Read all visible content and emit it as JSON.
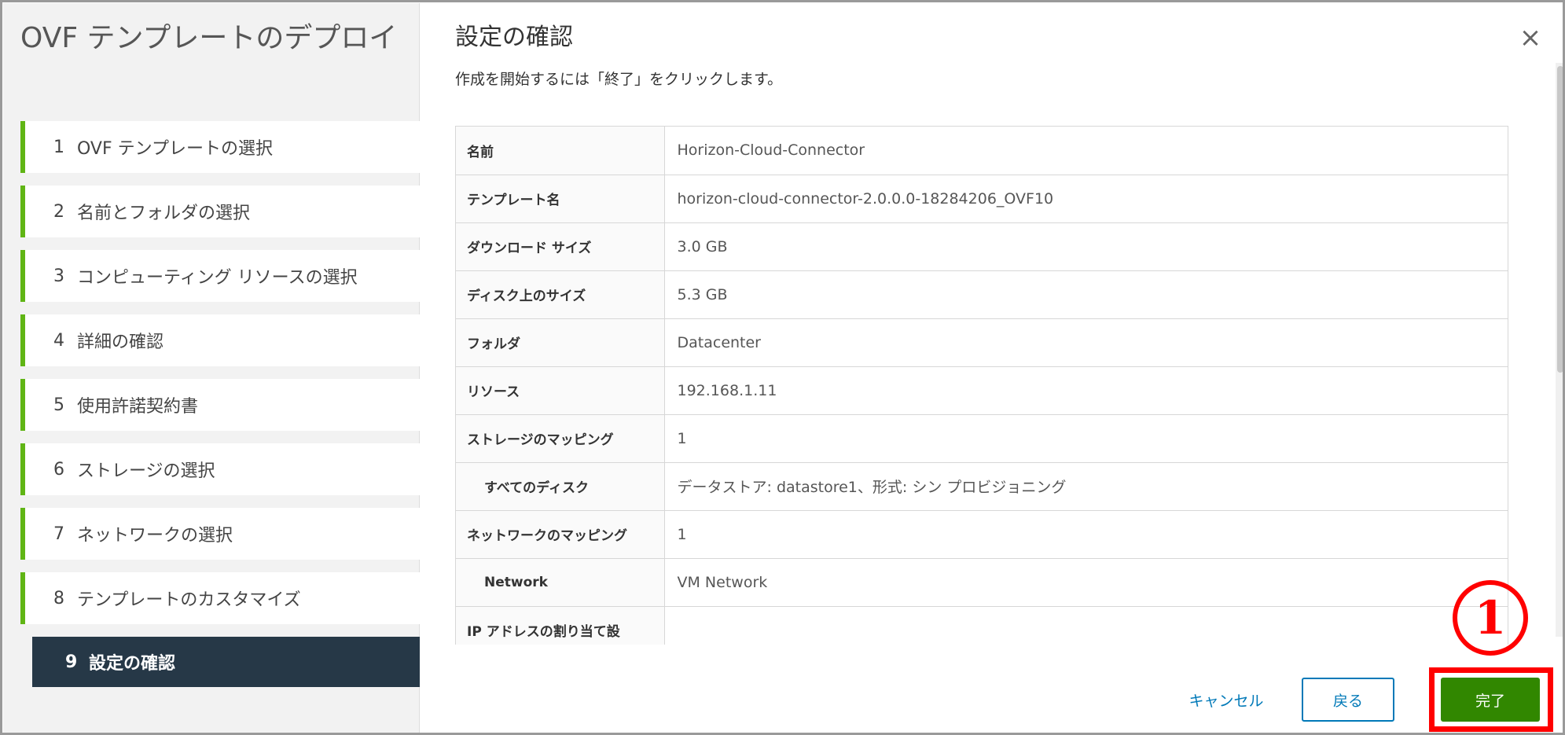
{
  "wizard": {
    "title": "OVF テンプレートのデプロイ",
    "steps": [
      {
        "num": "1",
        "label": "OVF テンプレートの選択"
      },
      {
        "num": "2",
        "label": "名前とフォルダの選択"
      },
      {
        "num": "3",
        "label": "コンピューティング リソースの選択"
      },
      {
        "num": "4",
        "label": "詳細の確認"
      },
      {
        "num": "5",
        "label": "使用許諾契約書"
      },
      {
        "num": "6",
        "label": "ストレージの選択"
      },
      {
        "num": "7",
        "label": "ネットワークの選択"
      },
      {
        "num": "8",
        "label": "テンプレートのカスタマイズ"
      },
      {
        "num": "9",
        "label": "設定の確認"
      }
    ],
    "active_step": 9
  },
  "page": {
    "title": "設定の確認",
    "description": "作成を開始するには「終了」をクリックします。",
    "close_icon": "×"
  },
  "summary": [
    {
      "key": "名前",
      "value": "Horizon-Cloud-Connector"
    },
    {
      "key": "テンプレート名",
      "value": "horizon-cloud-connector-2.0.0.0-18284206_OVF10"
    },
    {
      "key": "ダウンロード サイズ",
      "value": "3.0 GB"
    },
    {
      "key": "ディスク上のサイズ",
      "value": "5.3 GB"
    },
    {
      "key": "フォルダ",
      "value": "Datacenter"
    },
    {
      "key": "リソース",
      "value": "192.168.1.11"
    },
    {
      "key": "ストレージのマッピング",
      "value": "1"
    },
    {
      "key": "すべてのディスク",
      "value": "データストア: datastore1、形式: シン プロビジョニング"
    },
    {
      "key": "ネットワークのマッピング",
      "value": "1"
    },
    {
      "key": "Network",
      "value": "VM Network"
    },
    {
      "key": "IP アドレスの割り当て設",
      "value": ""
    }
  ],
  "footer": {
    "cancel_label": "キャンセル",
    "back_label": "戻る",
    "finish_label": "完了"
  },
  "annotation": {
    "marker": "①",
    "color": "#ff0000"
  },
  "colors": {
    "accent_green": "#60b515",
    "active_step_bg": "#263847",
    "primary_blue": "#0079b8",
    "finish_green": "#318700"
  }
}
